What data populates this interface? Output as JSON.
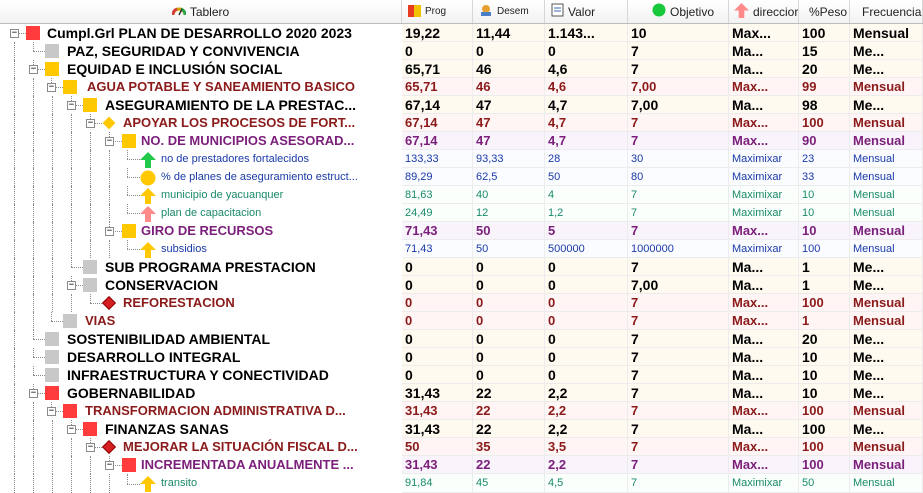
{
  "header": {
    "tablero": "Tablero",
    "prog": "Prog",
    "desem": "Desem",
    "valor": "Valor",
    "objetivo": "Objetivo",
    "direccion": "direccior",
    "peso": "%Peso",
    "frecuencia": "Frecuencia"
  },
  "colors": {
    "red": "#ff3b3b",
    "yellow": "#ffc800",
    "gray": "#c8c8c8",
    "green": "#22c84a",
    "pink": "#ff8a8a"
  },
  "rows": [
    {
      "name": "Cumpl.Grl PLAN DE DESARROLLO 2020 2023",
      "prog": "19,22",
      "desem": "11,44",
      "valor": "1.143...",
      "objetivo": "10",
      "dir": "Max...",
      "peso": "100",
      "frec": "Mensual",
      "icon": "red-square-icon"
    },
    {
      "name": "PAZ, SEGURIDAD Y CONVIVENCIA",
      "prog": "0",
      "desem": "0",
      "valor": "0",
      "objetivo": "7",
      "dir": "Ma...",
      "peso": "15",
      "frec": "Me...",
      "icon": "gray-square-icon"
    },
    {
      "name": "EQUIDAD E INCLUSIÓN SOCIAL",
      "prog": "65,71",
      "desem": "46",
      "valor": "4,6",
      "objetivo": "7",
      "dir": "Ma...",
      "peso": "20",
      "frec": "Me...",
      "icon": "yellow-square-icon"
    },
    {
      "name": "AGUA POTABLE Y SANEAMIENTO BASICO",
      "prog": "65,71",
      "desem": "46",
      "valor": "4,6",
      "objetivo": "7,00",
      "dir": "Max...",
      "peso": "99",
      "frec": "Mensual",
      "icon": "yellow-square-icon"
    },
    {
      "name": "ASEGURAMIENTO DE LA PRESTAC...",
      "prog": "67,14",
      "desem": "47",
      "valor": "4,7",
      "objetivo": "7,00",
      "dir": "Ma...",
      "peso": "98",
      "frec": "Me...",
      "icon": "yellow-square-icon"
    },
    {
      "name": "APOYAR LOS PROCESOS DE FORT...",
      "prog": "67,14",
      "desem": "47",
      "valor": "4,7",
      "objetivo": "7",
      "dir": "Max...",
      "peso": "100",
      "frec": "Mensual",
      "icon": "yellow-diamond-icon"
    },
    {
      "name": "NO. DE MUNICIPIOS ASESORAD...",
      "prog": "67,14",
      "desem": "47",
      "valor": "4,7",
      "objetivo": "7",
      "dir": "Max...",
      "peso": "90",
      "frec": "Mensual",
      "icon": "yellow-square-icon"
    },
    {
      "name": "no de prestadores fortalecidos",
      "prog": "133,33",
      "desem": "93,33",
      "valor": "28",
      "objetivo": "30",
      "dir": "Maximixar",
      "peso": "23",
      "frec": "Mensual",
      "icon": "green-arrow-up-icon"
    },
    {
      "name": "% de planes de aseguramiento estruct...",
      "prog": "89,29",
      "desem": "62,5",
      "valor": "50",
      "objetivo": "80",
      "dir": "Maximixar",
      "peso": "33",
      "frec": "Mensual",
      "icon": "yellow-circle-icon"
    },
    {
      "name": "municipio de yacuanquer",
      "prog": "81,63",
      "desem": "40",
      "valor": "4",
      "objetivo": "7",
      "dir": "Maximixar",
      "peso": "10",
      "frec": "Mensual",
      "icon": "yellow-arrow-up-icon"
    },
    {
      "name": "plan de capacitacion",
      "prog": "24,49",
      "desem": "12",
      "valor": "1,2",
      "objetivo": "7",
      "dir": "Maximixar",
      "peso": "10",
      "frec": "Mensual",
      "icon": "pink-arrow-up-icon"
    },
    {
      "name": "GIRO DE RECURSOS",
      "prog": "71,43",
      "desem": "50",
      "valor": "5",
      "objetivo": "7",
      "dir": "Max...",
      "peso": "10",
      "frec": "Mensual",
      "icon": "yellow-square-icon"
    },
    {
      "name": "subsidios",
      "prog": "71,43",
      "desem": "50",
      "valor": "500000",
      "objetivo": "1000000",
      "dir": "Maximixar",
      "peso": "100",
      "frec": "Mensual",
      "icon": "yellow-arrow-up-icon"
    },
    {
      "name": "SUB PROGRAMA PRESTACION",
      "prog": "0",
      "desem": "0",
      "valor": "0",
      "objetivo": "7",
      "dir": "Ma...",
      "peso": "1",
      "frec": "Me...",
      "icon": "gray-square-icon"
    },
    {
      "name": "CONSERVACION",
      "prog": "0",
      "desem": "0",
      "valor": "0",
      "objetivo": "7,00",
      "dir": "Ma...",
      "peso": "1",
      "frec": "Me...",
      "icon": "gray-square-icon"
    },
    {
      "name": "REFORESTACION",
      "prog": "0",
      "desem": "0",
      "valor": "0",
      "objetivo": "7",
      "dir": "Max...",
      "peso": "100",
      "frec": "Mensual",
      "icon": "red-diamond-icon"
    },
    {
      "name": "VIAS",
      "prog": "0",
      "desem": "0",
      "valor": "0",
      "objetivo": "7",
      "dir": "Max...",
      "peso": "1",
      "frec": "Mensual",
      "icon": "gray-square-icon"
    },
    {
      "name": "SOSTENIBILIDAD AMBIENTAL",
      "prog": "0",
      "desem": "0",
      "valor": "0",
      "objetivo": "7",
      "dir": "Ma...",
      "peso": "20",
      "frec": "Me...",
      "icon": "gray-square-icon"
    },
    {
      "name": "DESARROLLO INTEGRAL",
      "prog": "0",
      "desem": "0",
      "valor": "0",
      "objetivo": "7",
      "dir": "Ma...",
      "peso": "10",
      "frec": "Me...",
      "icon": "gray-square-icon"
    },
    {
      "name": "INFRAESTRUCTURA Y CONECTIVIDAD",
      "prog": "0",
      "desem": "0",
      "valor": "0",
      "objetivo": "7",
      "dir": "Ma...",
      "peso": "10",
      "frec": "Me...",
      "icon": "gray-square-icon"
    },
    {
      "name": "GOBERNABILIDAD",
      "prog": "31,43",
      "desem": "22",
      "valor": "2,2",
      "objetivo": "7",
      "dir": "Ma...",
      "peso": "10",
      "frec": "Me...",
      "icon": "red-square-icon"
    },
    {
      "name": "TRANSFORMACION ADMINISTRATIVA D...",
      "prog": "31,43",
      "desem": "22",
      "valor": "2,2",
      "objetivo": "7",
      "dir": "Max...",
      "peso": "100",
      "frec": "Mensual",
      "icon": "red-square-icon"
    },
    {
      "name": "FINANZAS SANAS",
      "prog": "31,43",
      "desem": "22",
      "valor": "2,2",
      "objetivo": "7",
      "dir": "Ma...",
      "peso": "100",
      "frec": "Me...",
      "icon": "red-square-icon"
    },
    {
      "name": "MEJORAR LA SITUACIÓN FISCAL D...",
      "prog": "50",
      "desem": "35",
      "valor": "3,5",
      "objetivo": "7",
      "dir": "Max...",
      "peso": "100",
      "frec": "Mensual",
      "icon": "red-diamond-icon"
    },
    {
      "name": "INCREMENTADA ANUALMENTE ...",
      "prog": "31,43",
      "desem": "22",
      "valor": "2,2",
      "objetivo": "7",
      "dir": "Max...",
      "peso": "100",
      "frec": "Mensual",
      "icon": "red-square-icon"
    },
    {
      "name": "transito",
      "prog": "91,84",
      "desem": "45",
      "valor": "4,5",
      "objetivo": "7",
      "dir": "Maximixar",
      "peso": "50",
      "frec": "Mensual",
      "icon": "yellow-arrow-up-icon"
    }
  ]
}
